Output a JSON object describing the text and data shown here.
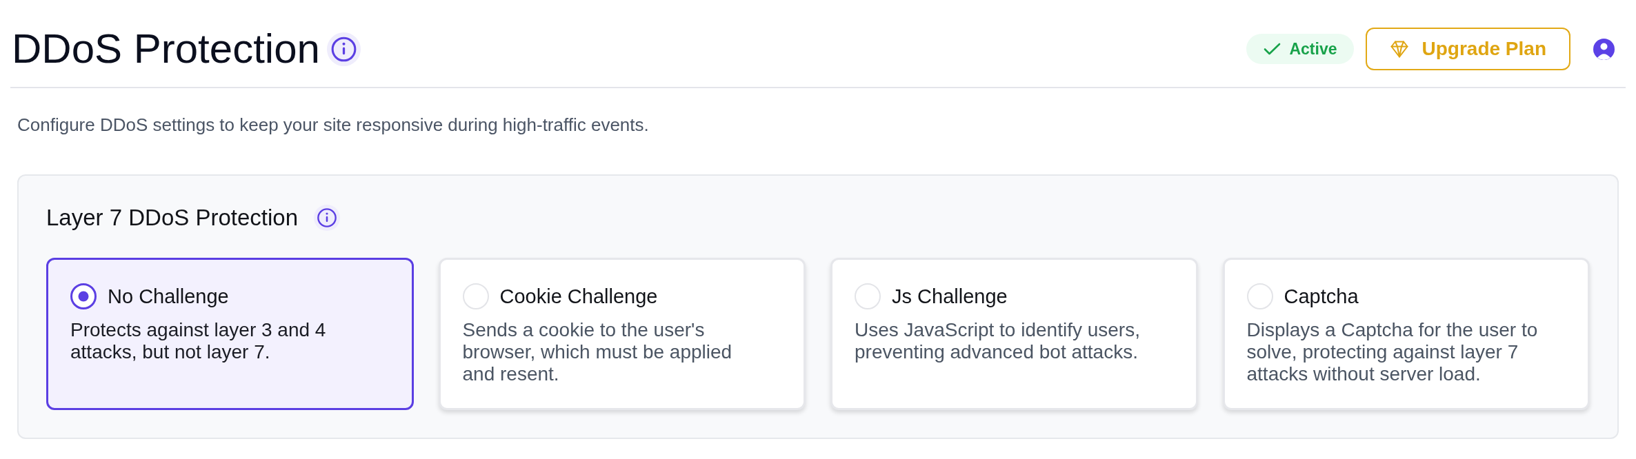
{
  "header": {
    "title": "DDoS Protection",
    "status": {
      "label": "Active"
    },
    "upgrade_button": {
      "label": "Upgrade Plan"
    }
  },
  "description": "Configure DDoS settings to keep your site responsive during high-traffic events.",
  "section": {
    "title": "Layer 7 DDoS Protection",
    "options": [
      {
        "label": "No Challenge",
        "description": "Protects against layer 3 and 4 attacks, but not layer 7.",
        "selected": true
      },
      {
        "label": "Cookie Challenge",
        "description": "Sends a cookie to the user's browser, which must be applied and resent.",
        "selected": false
      },
      {
        "label": "Js Challenge",
        "description": "Uses JavaScript to identify users, preventing advanced bot attacks.",
        "selected": false
      },
      {
        "label": "Captcha",
        "description": "Displays a Captcha for the user to solve, protecting against layer 7 attacks without server load.",
        "selected": false
      }
    ]
  }
}
